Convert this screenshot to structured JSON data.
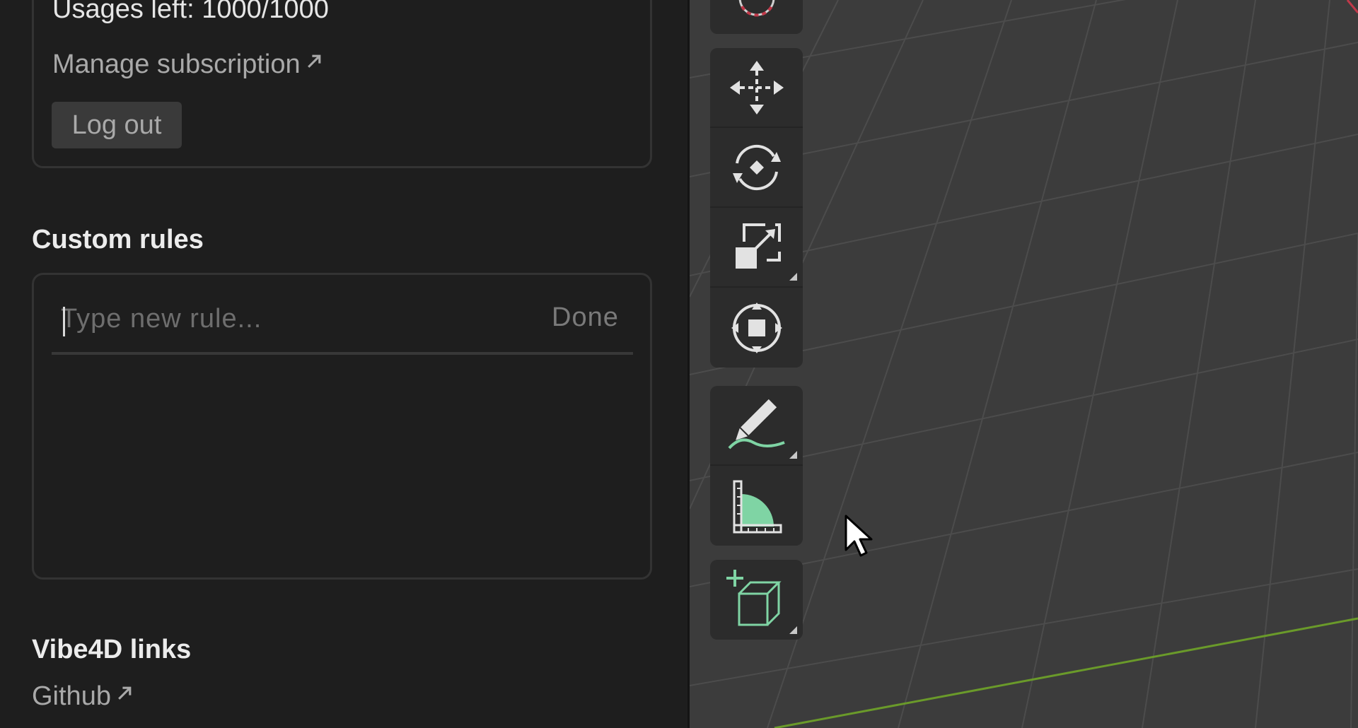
{
  "account": {
    "usages_text": "Usages left: 1000/1000",
    "manage_subscription_label": "Manage subscription",
    "logout_label": "Log out"
  },
  "custom_rules": {
    "title": "Custom rules",
    "input_value": "",
    "input_placeholder": "Type new rule...",
    "done_label": "Done"
  },
  "links": {
    "title": "Vibe4D links",
    "github_label": "Github"
  },
  "toolbar": {
    "groups": [
      {
        "tools": [
          "move-tool",
          "rotate-tool",
          "scale-tool",
          "transform-tool"
        ]
      },
      {
        "tools": [
          "annotate-tool",
          "measure-tool"
        ]
      },
      {
        "tools": [
          "add-cube-tool"
        ]
      }
    ]
  },
  "colors": {
    "panel_bg": "#1e1e1e",
    "viewport_bg": "#3c3c3c",
    "toolbar_bg": "#2c2c2c",
    "accent_green": "#7fd4a4",
    "y_axis": "#6a9a2a",
    "x_axis": "#c0394a"
  }
}
